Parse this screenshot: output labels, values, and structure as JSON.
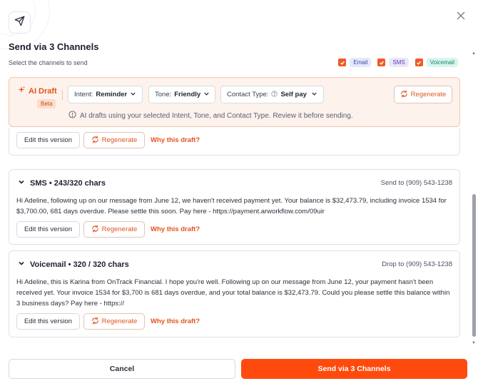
{
  "modal": {
    "title": "Send via 3 Channels",
    "subtitle": "Select the channels to send",
    "channels": [
      {
        "label": "Email",
        "checked": true
      },
      {
        "label": "SMS",
        "checked": true
      },
      {
        "label": "Voicemail",
        "checked": true
      }
    ]
  },
  "ai_draft": {
    "label": "AI Draft",
    "badge": "Beta",
    "intent": {
      "prefix": "Intent:",
      "value": "Reminder"
    },
    "tone": {
      "prefix": "Tone:",
      "value": "Friendly"
    },
    "contact_type": {
      "prefix": "Contact Type:",
      "value": "Self pay"
    },
    "regenerate_label": "Regenerate",
    "note": "AI drafts using your selected Intent, Tone, and Contact Type. Review it before sending."
  },
  "cards": {
    "email": {
      "edit_label": "Edit this version",
      "regenerate_label": "Regenerate",
      "why_label": "Why this draft?"
    },
    "sms": {
      "title": "SMS • 243/320 chars",
      "right": "Send to (909) 543-1238",
      "body": "Hi Adeline, following up on our message from June 12, we haven't received payment yet. Your balance is $32,473.79, including invoice 1534 for $3,700.00, 681 days overdue. Please settle this soon. Pay here - https://payment.arworkflow.com/09uir",
      "edit_label": "Edit this version",
      "regenerate_label": "Regenerate",
      "why_label": "Why this draft?"
    },
    "voicemail": {
      "title": "Voicemail • 320 / 320 chars",
      "right": "Drop to (909) 543-1238",
      "body": "Hi Adeline, this is Karina from OnTrack Financial. I hope you're well. Following up on our message from June 12, your payment hasn't been received yet. Your invoice 1534 for $3,700 is 681 days overdue, and your total balance is $32,473.79. Could you please settle this balance within 3 business days? Pay here - https://",
      "edit_label": "Edit this version",
      "regenerate_label": "Regenerate",
      "why_label": "Why this draft?"
    }
  },
  "footer": {
    "cancel_label": "Cancel",
    "send_label": "Send via 3 Channels"
  },
  "colors": {
    "accent": "#ff4a0d",
    "accent_text": "#e2541f",
    "ai_panel_bg": "#fdf2ec"
  },
  "icons": {
    "header": "paper-plane-icon",
    "close": "close-icon",
    "ai": "sparkle-icon",
    "regenerate": "refresh-icon",
    "info": "info-icon",
    "help": "question-icon",
    "collapse": "chevron-down-icon"
  }
}
